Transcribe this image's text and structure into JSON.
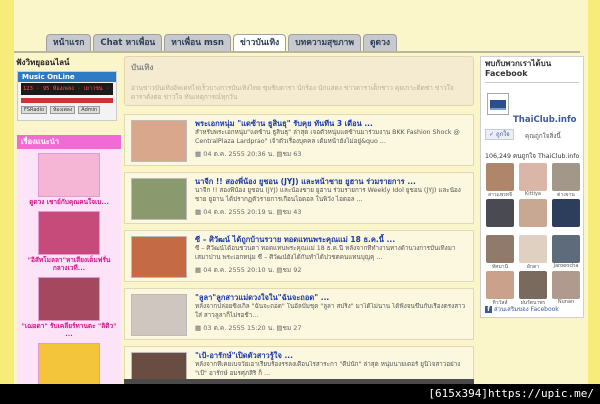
{
  "tabs": [
    {
      "label": "หน้าแรก",
      "active": false
    },
    {
      "label": "Chat หาเพื่อน",
      "active": false
    },
    {
      "label": "หาเพื่อน msn",
      "active": false
    },
    {
      "label": "ข่าวบันเทิง",
      "active": true
    },
    {
      "label": "บทความสุขภาพ",
      "active": false
    },
    {
      "label": "ดูดวง",
      "active": false
    }
  ],
  "radio": {
    "title": "ฟังวิทยุออนไลน์",
    "player_title": "Music OnLine",
    "screen_text": "123 · 95 ห้องเพลง · เยาวชน · วัยรุ่น",
    "buttons": [
      "FSRadio",
      "ห้องเพลง",
      "Admin"
    ]
  },
  "recommend": {
    "heading": "เรื่องแนะนำ",
    "items": [
      {
        "text": "ดูดวง เชาย์กับคุณคนใจเบ...",
        "color": "#f5b6d6"
      },
      {
        "text": "\"อิสัทโมลลา\"หาเสียงเด็มฟรั่น กลางเวที...",
        "color": "#c74b7a"
      },
      {
        "text": "\"เฌอดา\" รับเคลียร์ทานตะ \"ลิดิว\" ...",
        "color": "#a3485e"
      },
      {
        "text": "",
        "color": "#f3c53a"
      }
    ]
  },
  "category": {
    "title": "บันเทิง",
    "description": "อ่านข่าวบันเทิงอัพเดทไฟเร็วบางการบันเทิงไทย ซุบซิบดารา นักร้อง นักแสดง ข่าวดาราเด็กชาว คุยเกาะติดซ่า ข่าวใจดาราดังต่อ ข่าวใจ ทันเหตุการณ์ทุกวัน"
  },
  "posts": [
    {
      "title": "พระเอกหนุ่ม \"แดซ้าน ธูสินธุ\" รับคุย ทันทีน 3 เดือน ...",
      "excerpt": "สำหรับพระเอกหนุ่ม\"แดซ้าน ธูสินธุ\" ล่าสุด เจอตัวหนุ่มแดซ้านมาร่วมงาน BKK Fashion Shock @ CentralPlaza Lardprao\" เจ้าตัวเรื่องบุคคล เด้มหน้ายังไม่อยู่&quo ...",
      "date": "04 ต.ค. 2555 20:36 น.",
      "views": "ชม 63",
      "color": "#d9a88c"
    },
    {
      "title": "นาจีก !! สองพี่น้อง ยูชอน (JYJ) และหน้าชาย ยูฮาน ร่วมรายการ ...",
      "excerpt": "นาจีก !! สองพี่น้อง ยูชอน (JYJ) และน้องชาย ยูฮาน ร่วมรายการ Weekly Idol ยูชอน (JYJ) และน้องชาย ยูฮาน ได้ปรากฏตัวรายการเกือนไอดอล ในพิวัง ไอดอล ...",
      "date": "04 ต.ค. 2555 20:19 น.",
      "views": "ชม 43",
      "color": "#8b9a6e"
    },
    {
      "title": "ซี – ศิวัฒน์ ได้ถูกบ้านรวาย ทอดแทนพระคุณแม่ 18 ธ.ค.นี้ ...",
      "excerpt": "ซี – ศิวัฒน์ได้อนชวนตา ทอดแทนพระคุณแม่ 18 ธ.ค.นี้ หลังจากที่ทำงานทางด้านวงการบันเทิงมาเสมาปาน พระเอกหนุ่ม ซี – ศิวัฒน์ยังได้กันทำได้ปวชตคนแทนบุญคุ ...",
      "date": "04 ต.ค. 2555 20:10 น.",
      "views": "ชม 92",
      "color": "#c46a44"
    },
    {
      "title": "\"ลูลา\"ลูกสาวแม่ดวงใจใน\"ฉันจะถอด\" ...",
      "excerpt": "หลังจากปล่อยซิงเกิ้ล \"ฉันจะถอด\" ในอัลบั้มชุด \"ลูลา สปริง\" มาได้ไม่นาน ได้ฟังจนขึ้นกับเรื่องตรงสาวใส่ สาวลูลาก็ไม่รอช้า...",
      "date": "03 ต.ค. 2555 15:20 น.",
      "views": "ชม 27",
      "color": "#cfc6c0"
    },
    {
      "title": "\"เป้-อารักษ์\"เปิดตัวสาวรู้ใจ ...",
      "excerpt": "หลังจากที่เคยเบจวัยเอาเรียบร้องรรลงเดือนไรสาระกา \"ดีปนัก\" ล่าสุด หนุ่มนายเดอร์ ยูนิโจสาวอย่าง \"เป้\" อารักษ์ อมรศุภสิริ ก็ ...",
      "date": "",
      "views": "",
      "color": "#6a4d42"
    }
  ],
  "facebook": {
    "title": "พบกับพวกเราได้บน Facebook",
    "page_name": "ThaiClub.info",
    "like_button": "ถูกใจ",
    "like_text": "คุณถูกใจสิ่งนี้",
    "count_text": "106,249 คนถูกใจ ThaiClub.info",
    "fans": [
      {
        "name": "สาวแพรทจี",
        "color": "#b0866a"
      },
      {
        "name": "Kittiya",
        "color": "#d9b6a8"
      },
      {
        "name": "ต่างจาน",
        "color": "#a39789"
      },
      {
        "name": "",
        "color": "#4a4a52"
      },
      {
        "name": "",
        "color": "#c8a893"
      },
      {
        "name": "",
        "color": "#2d3d5c"
      },
      {
        "name": "ทัศมานี",
        "color": "#8f7a6b"
      },
      {
        "name": "ผักตา",
        "color": "#e0d0c2"
      },
      {
        "name": "Jaroencha",
        "color": "#5d6b7a"
      },
      {
        "name": "ทิววัสส์",
        "color": "#caa18b"
      },
      {
        "name": "ฝนรัตนาพร",
        "color": "#7a6a5e"
      },
      {
        "name": "Nunan",
        "color": "#b09a8d"
      }
    ],
    "plugin_text": "ส่วนเสริมของ Facebook"
  },
  "watermark": "[615x394]https://upic.me/"
}
